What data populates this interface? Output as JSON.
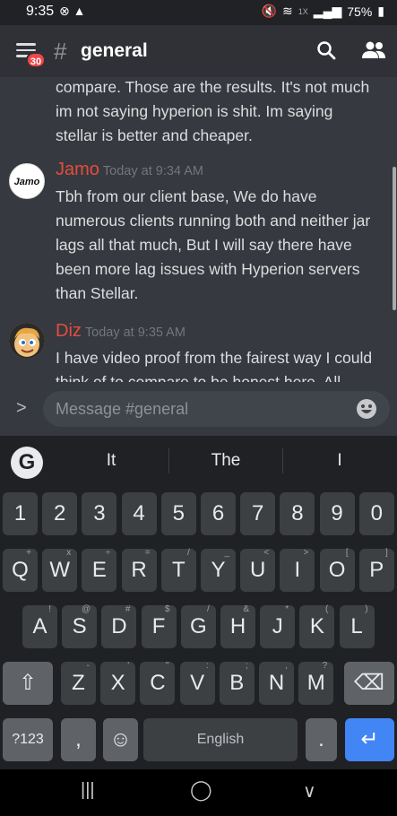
{
  "status": {
    "time": "9:35",
    "battery": "75%",
    "network": "1X"
  },
  "header": {
    "badge_count": "30",
    "channel": "general"
  },
  "messages": {
    "continuation_lines": [
      "compare. Those are the results. It's not much",
      "im not saying hyperion is shit. Im saying",
      "stellar is better and cheaper."
    ],
    "items": [
      {
        "author": "Jamo",
        "timestamp": "Today at 9:34 AM",
        "avatar_text": "Jamo",
        "lines": [
          "Tbh from our client base, We do have",
          "numerous clients running both and neither jar",
          "lags all that much, But I will say there have",
          "been more lag issues with Hyperion servers",
          "than Stellar."
        ]
      },
      {
        "author": "Diz",
        "timestamp": "Today at 9:35 AM",
        "lines": [
          "I have video proof from the fairest way I could",
          "think of to compare to be honest here. All"
        ]
      }
    ]
  },
  "input": {
    "placeholder": "Message #general"
  },
  "keyboard": {
    "suggestions": [
      "It",
      "The",
      "I"
    ],
    "row_numbers": [
      "1",
      "2",
      "3",
      "4",
      "5",
      "6",
      "7",
      "8",
      "9",
      "0"
    ],
    "row_q": [
      {
        "k": "Q",
        "h": "+"
      },
      {
        "k": "W",
        "h": "x"
      },
      {
        "k": "E",
        "h": "÷"
      },
      {
        "k": "R",
        "h": "="
      },
      {
        "k": "T",
        "h": "/"
      },
      {
        "k": "Y",
        "h": "_"
      },
      {
        "k": "U",
        "h": "<"
      },
      {
        "k": "I",
        "h": ">"
      },
      {
        "k": "O",
        "h": "["
      },
      {
        "k": "P",
        "h": "]"
      }
    ],
    "row_a": [
      {
        "k": "A",
        "h": "!"
      },
      {
        "k": "S",
        "h": "@"
      },
      {
        "k": "D",
        "h": "#"
      },
      {
        "k": "F",
        "h": "$"
      },
      {
        "k": "G",
        "h": "/"
      },
      {
        "k": "H",
        "h": "&"
      },
      {
        "k": "J",
        "h": "*"
      },
      {
        "k": "K",
        "h": "("
      },
      {
        "k": "L",
        "h": ")"
      }
    ],
    "row_z": [
      {
        "k": "Z",
        "h": "-"
      },
      {
        "k": "X",
        "h": "'"
      },
      {
        "k": "C",
        "h": "\""
      },
      {
        "k": "V",
        "h": ":"
      },
      {
        "k": "B",
        "h": ";"
      },
      {
        "k": "N",
        "h": ","
      },
      {
        "k": "M",
        "h": "?"
      }
    ],
    "sym_label": "?123",
    "comma": ",",
    "space_label": "English",
    "period": "."
  },
  "colors": {
    "author": "#e74c3c",
    "enter": "#4285f4",
    "badge": "#f04747"
  }
}
